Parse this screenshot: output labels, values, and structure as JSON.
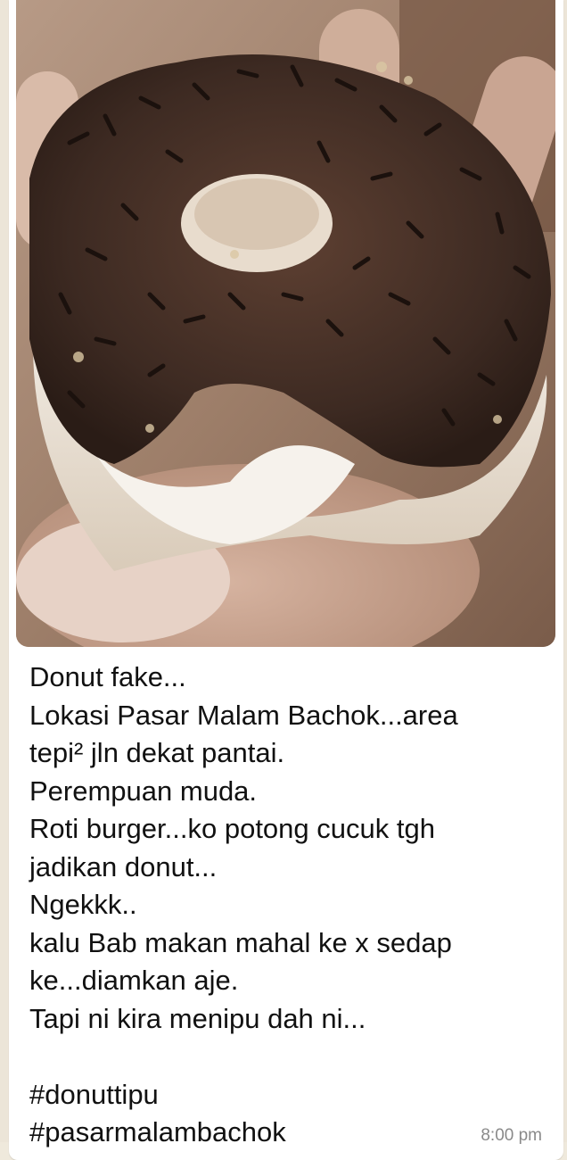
{
  "message": {
    "photo_alt": "donut-photo",
    "caption_lines": [
      "Donut fake...",
      "Lokasi Pasar Malam Bachok...area",
      "tepi² jln dekat pantai.",
      "Perempuan muda.",
      "Roti burger...ko potong cucuk tgh",
      "jadikan donut...",
      "Ngekkk..",
      "kalu Bab makan mahal ke x sedap",
      "ke...diamkan aje.",
      "Tapi ni kira menipu dah ni...",
      "",
      "#donuttipu",
      "#pasarmalambachok"
    ],
    "timestamp": "8:00 pm"
  },
  "colors": {
    "chat_background": "#ece5d8",
    "bubble": "#ffffff",
    "text": "#111111",
    "timestamp": "#8a8a8a"
  }
}
